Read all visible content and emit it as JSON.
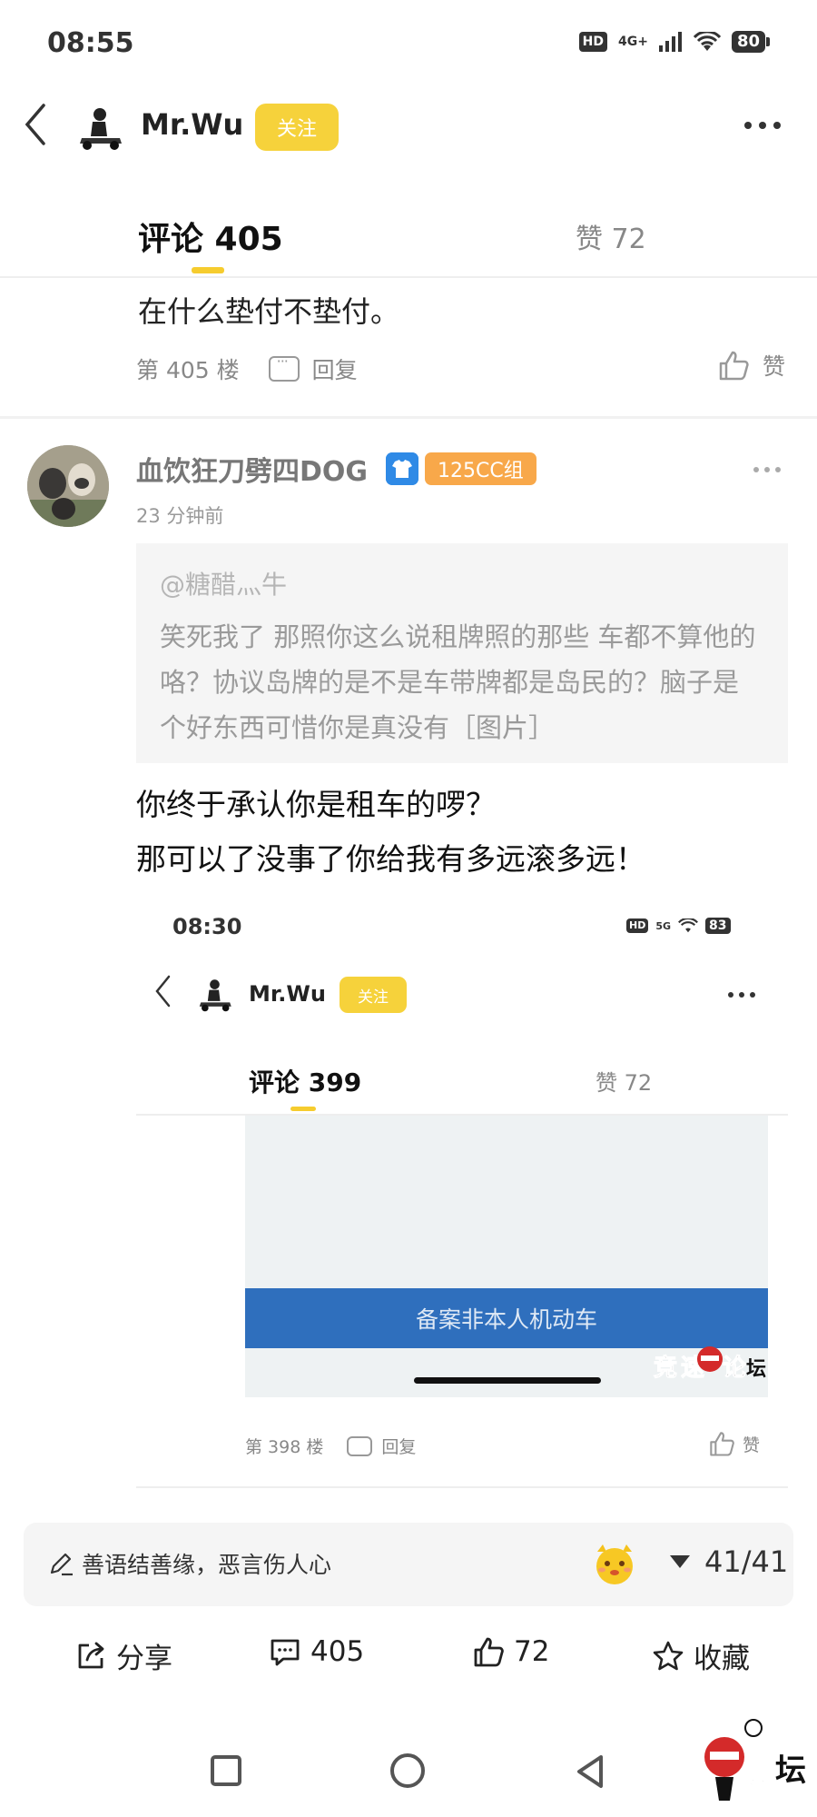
{
  "status_bar": {
    "time": "08:55",
    "hd": "HD",
    "network": "4G+",
    "battery": "80"
  },
  "header": {
    "author_name": "Mr.Wu",
    "follow_label": "关注"
  },
  "tabs": {
    "comments": "评论 405",
    "likes": "赞 72"
  },
  "comment_prev": {
    "text": "在什么垫付不垫付。",
    "floor": "第 405 楼",
    "reply_label": "回复",
    "like_label": "赞"
  },
  "comment": {
    "username": "血饮狂刀劈四DOG",
    "level_badge": "125CC组",
    "time": "23 分钟前",
    "quote_user": "@糖醋灬牛",
    "quote_text": "笑死我了 那照你这么说租牌照的那些 车都不算他的咯？协议岛牌的是不是车带牌都是岛民的？脑子是个好东西可惜你是真没有［图片］",
    "body_line1": "你终于承认你是租车的啰？",
    "body_line2": "那可以了没事了你给我有多远滚多远！"
  },
  "embedded_screenshot": {
    "status_time": "08:30",
    "hd": "HD",
    "network": "5G",
    "battery": "83",
    "author_name": "Mr.Wu",
    "follow_label": "关注",
    "tab_comments": "评论 399",
    "tab_likes": "赞 72",
    "banner_text": "备案非本人机动车",
    "floor": "第 398 楼",
    "reply_label": "回复",
    "like_label": "赞"
  },
  "input_bar": {
    "placeholder": "善语结善缘，恶言伤人心",
    "page_indicator": "41/41"
  },
  "actions": {
    "share": "分享",
    "comments": "405",
    "likes": "72",
    "favorite": "收藏"
  }
}
